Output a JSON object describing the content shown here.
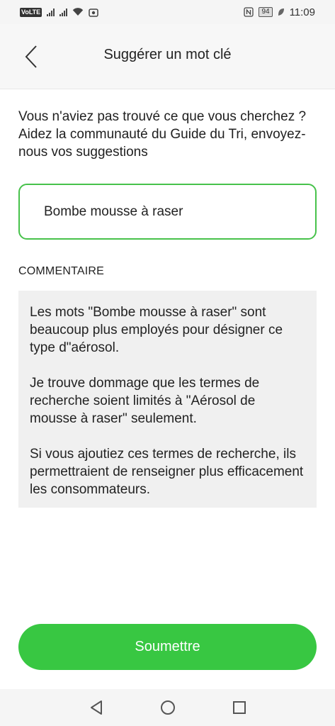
{
  "status_bar": {
    "volte": "VoLTE",
    "battery": "94",
    "time": "11:09"
  },
  "header": {
    "title": "Suggérer un mot clé"
  },
  "intro": {
    "text": "Vous n'aviez pas trouvé ce que vous cherchez ? Aidez la communauté du Guide du Tri, envoyez-nous vos suggestions"
  },
  "keyword": {
    "value": "Bombe mousse à raser"
  },
  "comment": {
    "label": "COMMENTAIRE",
    "paragraphs": [
      "Les mots \"Bombe mousse à raser\" sont beaucoup plus employés pour désigner ce type d\"aérosol.",
      "Je trouve dommage que les termes de recherche soient limités à \"Aérosol de mousse à raser\" seulement.",
      "Si vous ajoutiez ces termes de recherche, ils permettraient de renseigner plus efficacement les consommateurs."
    ]
  },
  "submit": {
    "label": "Soumettre"
  },
  "colors": {
    "accent": "#38c742",
    "input_border": "#47c24b",
    "comment_bg": "#f0f0f0"
  },
  "icons": [
    "back-chevron-icon",
    "nav-back-icon",
    "nav-home-icon",
    "nav-recents-icon",
    "nfc-icon",
    "wifi-icon",
    "leaf-icon"
  ]
}
